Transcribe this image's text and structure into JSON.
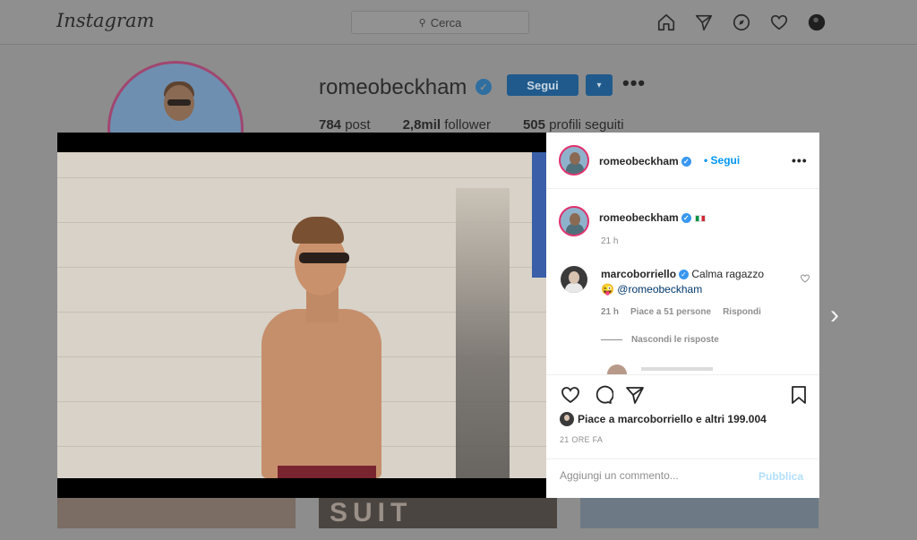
{
  "app": {
    "logo": "Instagram"
  },
  "search": {
    "label": "Cerca",
    "icon": "search-icon"
  },
  "nav": {
    "icons": [
      "home-icon",
      "direct-icon",
      "explore-icon",
      "heart-icon",
      "profile-avatar-icon"
    ]
  },
  "profile": {
    "username": "romeobeckham",
    "follow_label": "Segui",
    "dropdown_glyph": "▾",
    "more_glyph": "•••",
    "posts": "784",
    "posts_label": "post",
    "followers": "2,8mil",
    "followers_label": "follower",
    "following": "505",
    "following_label": "profili seguiti"
  },
  "grid_peek": {
    "middle_text": "SUIT"
  },
  "post": {
    "author": "romeobeckham",
    "follow_sep": "•",
    "follow_label": "Segui",
    "more_glyph": "•••",
    "caption_time": "21 h",
    "comment": {
      "user": "marcoborriello",
      "text": "Calma ragazzo",
      "emoji": "😜",
      "mention": "@romeobeckham",
      "time": "21 h",
      "likes": "Piace a 51 persone",
      "reply_label": "Rispondi"
    },
    "hide_replies": "Nascondi le risposte",
    "likes_text": "Piace a marcoborriello e altri 199.004",
    "date": "21 ORE FA",
    "comment_placeholder": "Aggiungi un commento...",
    "publish_label": "Pubblica"
  },
  "next_arrow": "›",
  "colors": {
    "accent": "#0095f6",
    "follow_dim": "#205a8c",
    "ring": "#e1306c"
  }
}
